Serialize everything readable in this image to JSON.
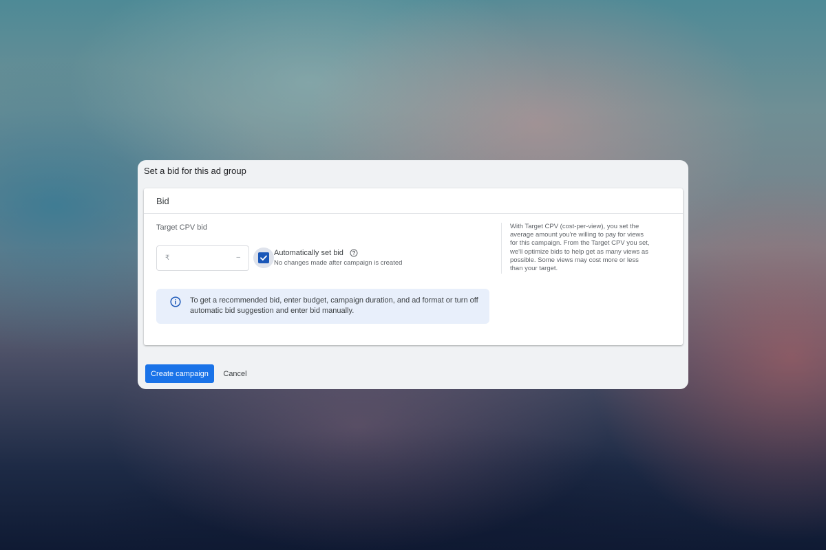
{
  "dialog": {
    "title": "Set a bid for this ad group",
    "section_title": "Bid",
    "field_label": "Target CPV bid",
    "bid_input": {
      "currency_symbol": "₹",
      "value": "",
      "trailing": "–"
    },
    "auto_bid": {
      "label": "Automatically set bid",
      "checked": true,
      "sublabel": "No changes made after campaign is created",
      "help_icon": "help-circle-icon"
    },
    "help_text": "With Target CPV (cost-per-view), you set the average amount you're willing to pay for views for this campaign. From the Target CPV you set, we'll optimize bids to help get as many views as possible. Some views may cost more or less than your target.",
    "info": {
      "icon": "info-icon",
      "text": "To get a recommended bid, enter budget, campaign duration, and ad format or turn off automatic bid suggestion and enter bid manually."
    },
    "buttons": {
      "create": "Create campaign",
      "cancel": "Cancel"
    }
  },
  "colors": {
    "primary": "#1a73e8",
    "checkbox": "#1a57b8",
    "info_bg": "#e8effb",
    "dialog_bg": "#f0f2f4"
  }
}
